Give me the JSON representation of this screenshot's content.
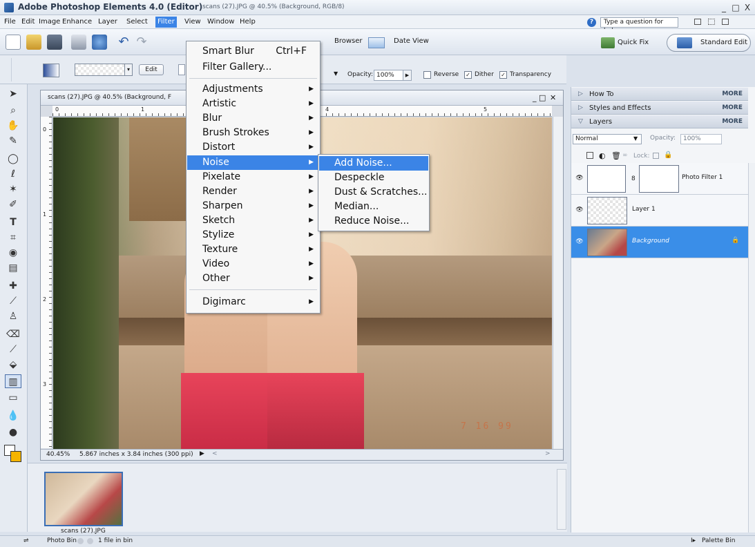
{
  "window": {
    "app_title": "Adobe Photoshop Elements 4.0 (Editor)",
    "doc_title": "scans (27).JPG @ 40.5% (Background, RGB/8)",
    "minimize": "_",
    "maximize": "□",
    "close": "X"
  },
  "menubar": {
    "items": [
      "File",
      "Edit",
      "Image",
      "Enhance",
      "Layer",
      "Select",
      "Filter",
      "View",
      "Window",
      "Help"
    ],
    "help_placeholder": "Type a question for help",
    "help_icon": "?"
  },
  "shortcuts": {
    "browser_label": "Browser",
    "date_view_label": "Date View",
    "quick_fix_label": "Quick Fix",
    "standard_edit_label": "Standard Edit"
  },
  "options": {
    "edit_label": "Edit",
    "opacity_label": "Opacity:",
    "opacity_value": "100%",
    "reverse_label": "Reverse",
    "reverse_checked": false,
    "dither_label": "Dither",
    "dither_checked": true,
    "transparency_label": "Transparency",
    "transparency_checked": true
  },
  "document": {
    "tab_title": "scans (27).JPG @ 40.5% (Background, F",
    "zoom": "40.45%",
    "info": "5.867 inches x 3.84 inches (300 ppi)",
    "ruler_top": [
      "0",
      "1",
      "4",
      "5"
    ],
    "ruler_left": [
      "0",
      "1",
      "2",
      "3"
    ],
    "photo_date_stamp": "7 16 99"
  },
  "filter_menu": {
    "items": [
      {
        "label": "Smart Blur",
        "shortcut": "Ctrl+F",
        "submenu": false
      },
      {
        "label": "Filter Gallery...",
        "shortcut": "",
        "submenu": false
      },
      {
        "label": "Adjustments",
        "shortcut": "",
        "submenu": true
      },
      {
        "label": "Artistic",
        "shortcut": "",
        "submenu": true
      },
      {
        "label": "Blur",
        "shortcut": "",
        "submenu": true
      },
      {
        "label": "Brush Strokes",
        "shortcut": "",
        "submenu": true
      },
      {
        "label": "Distort",
        "shortcut": "",
        "submenu": true
      },
      {
        "label": "Noise",
        "shortcut": "",
        "submenu": true,
        "highlighted": true
      },
      {
        "label": "Pixelate",
        "shortcut": "",
        "submenu": true
      },
      {
        "label": "Render",
        "shortcut": "",
        "submenu": true
      },
      {
        "label": "Sharpen",
        "shortcut": "",
        "submenu": true
      },
      {
        "label": "Sketch",
        "shortcut": "",
        "submenu": true
      },
      {
        "label": "Stylize",
        "shortcut": "",
        "submenu": true
      },
      {
        "label": "Texture",
        "shortcut": "",
        "submenu": true
      },
      {
        "label": "Video",
        "shortcut": "",
        "submenu": true
      },
      {
        "label": "Other",
        "shortcut": "",
        "submenu": true
      },
      {
        "label": "Digimarc",
        "shortcut": "",
        "submenu": true
      }
    ]
  },
  "noise_submenu": {
    "items": [
      {
        "label": "Add Noise...",
        "highlighted": true
      },
      {
        "label": "Despeckle"
      },
      {
        "label": "Dust & Scratches..."
      },
      {
        "label": "Median..."
      },
      {
        "label": "Reduce Noise..."
      }
    ]
  },
  "palette": {
    "how_to": "How To",
    "styles_effects": "Styles and Effects",
    "layers": "Layers",
    "more": "MORE",
    "blend_mode": "Normal",
    "opacity_label": "Opacity:",
    "opacity_value": "100%",
    "lock_label": "Lock:",
    "layers_list": [
      {
        "name": "Photo Filter 1",
        "selected": false
      },
      {
        "name": "Layer 1",
        "selected": false
      },
      {
        "name": "Background",
        "selected": true
      }
    ]
  },
  "photo_bin": {
    "caption": "scans (27).JPG",
    "label": "Photo Bin",
    "count": "1 file in bin",
    "palette_bin": "Palette Bin"
  }
}
